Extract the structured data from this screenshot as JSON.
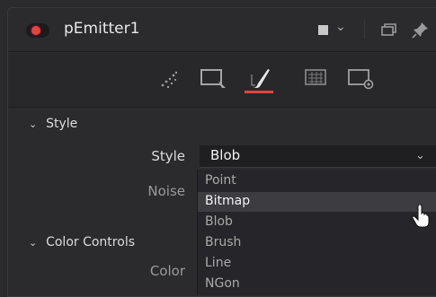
{
  "node": {
    "title": "pEmitter1"
  },
  "tabs": [
    "Controls",
    "Sets",
    "Style",
    "Region",
    "Settings"
  ],
  "style_section": {
    "header": "Style",
    "style_label": "Style",
    "style_value": "Blob",
    "noise_label": "Noise"
  },
  "color_section": {
    "header": "Color Controls",
    "color_label": "Color"
  },
  "dropdown": {
    "options": [
      "Point",
      "Bitmap",
      "Blob",
      "Brush",
      "Line",
      "NGon"
    ],
    "highlighted": "Bitmap"
  },
  "colors": {
    "accent": "#e0453d",
    "panel": "#2b2b2e",
    "highlight": "#3c3c41"
  }
}
